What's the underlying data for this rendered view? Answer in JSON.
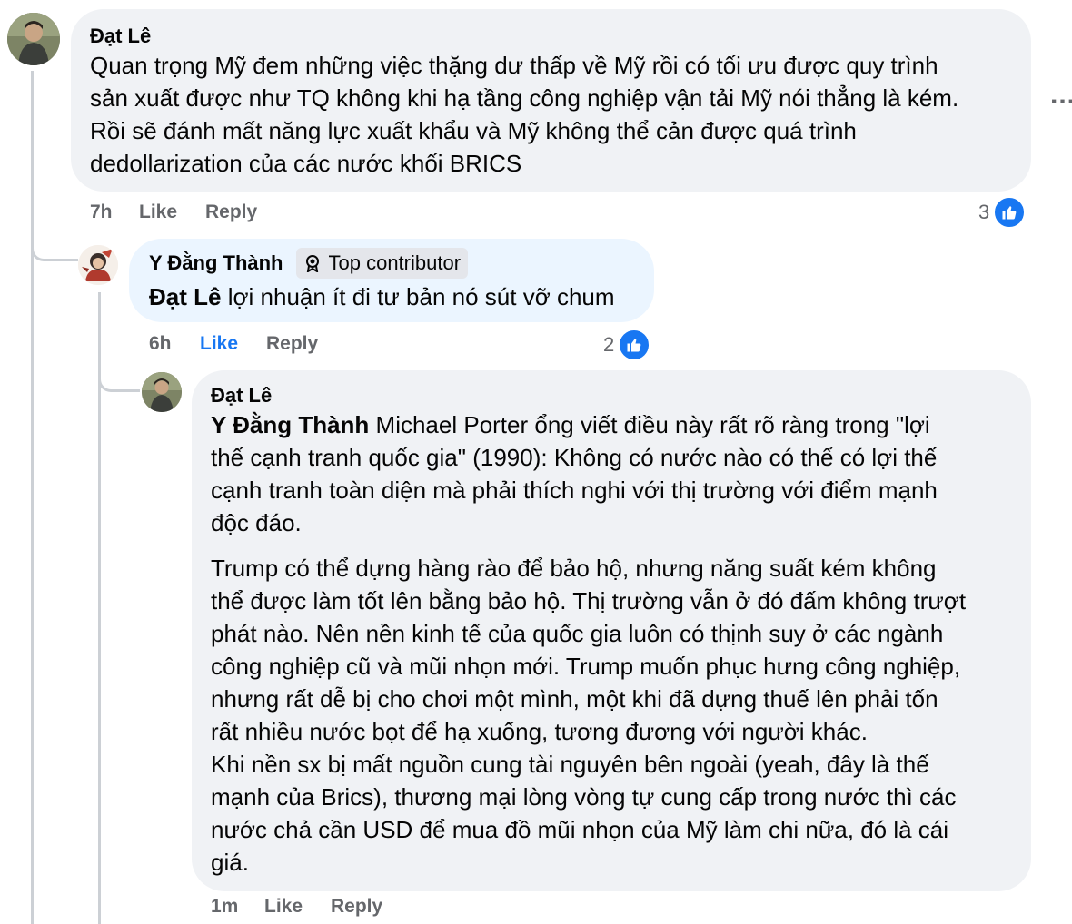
{
  "comment1": {
    "author": "Đạt Lê",
    "text_lines": [
      "Quan trọng Mỹ đem những việc thặng dư thấp về Mỹ rồi có tối ưu được quy trình",
      "sản xuất được như TQ không khi hạ tầng công nghiệp vận tải Mỹ nói thẳng là kém.",
      "Rồi sẽ đánh mất năng lực xuất khẩu và Mỹ không thể cản được quá trình",
      "dedollarization của các nước khối BRICS"
    ],
    "time": "7h",
    "like_label": "Like",
    "reply_label": "Reply",
    "reaction_count": "3",
    "more_label": "..."
  },
  "comment2": {
    "author": "Y Đằng Thành",
    "badge": "Top contributor",
    "mention": "Đạt Lê",
    "text": "lợi nhuận ít đi tư bản nó sút vỡ chum",
    "time": "6h",
    "like_label": "Like",
    "reply_label": "Reply",
    "reaction_count": "2"
  },
  "comment3": {
    "author": "Đạt Lê",
    "mention": "Y Đằng Thành",
    "p1_first": " Michael Porter ổng viết điều này rất rõ ràng trong \"lợi",
    "p1_lines": [
      "thế cạnh tranh quốc gia\" (1990): Không có nước nào có thể có lợi thế",
      "cạnh tranh toàn diện mà phải thích nghi với thị trường với điểm mạnh",
      "độc đáo."
    ],
    "p2_lines": [
      "Trump có thể dựng hàng rào để bảo hộ, nhưng năng suất kém không",
      "thể được làm tốt lên bằng bảo hộ. Thị trường vẫn ở đó đấm không trượt",
      "phát nào. Nên nền kinh tế của quốc gia luôn có thịnh suy ở các ngành",
      "công nghiệp cũ và mũi nhọn mới. Trump muốn phục hưng công nghiệp,",
      "nhưng rất dễ bị cho chơi một mình, một khi đã dựng thuế lên phải tốn",
      "rất nhiều nước bọt để hạ xuống, tương đương với người khác.",
      "Khi nền sx bị mất nguồn cung tài nguyên bên ngoài (yeah, đây là thế",
      "mạnh của Brics), thương mại lòng vòng tự cung cấp trong nước thì các",
      "nước chả cần USD để mua đồ mũi nhọn của Mỹ làm chi nữa, đó là cái",
      "giá."
    ],
    "time": "1m",
    "like_label": "Like",
    "reply_label": "Reply"
  },
  "icons": {
    "like": "thumbs-up-icon",
    "badge": "award-badge-icon",
    "more": "more-options-icon"
  },
  "colors": {
    "bubble": "#f0f2f5",
    "bubble_highlight": "#ebf5ff",
    "like_blue": "#1877f2",
    "muted": "#65676b"
  }
}
